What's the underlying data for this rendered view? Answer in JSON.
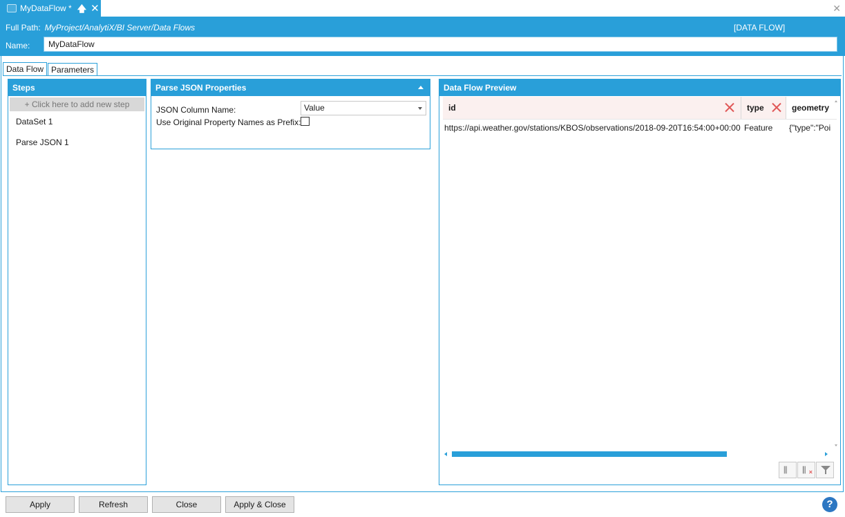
{
  "document_tab": {
    "title": "MyDataFlow *",
    "pin_glyph": "🡅",
    "close_glyph": "✕"
  },
  "window": {
    "close_glyph": "✕"
  },
  "header": {
    "full_path_label": "Full Path:",
    "full_path_value": "MyProject/AnalytiX/BI Server/Data Flows",
    "object_type": "[DATA FLOW]",
    "name_label": "Name:",
    "name_value": "MyDataFlow"
  },
  "tabs": [
    {
      "label": "Data Flow",
      "active": true
    },
    {
      "label": "Parameters",
      "active": false
    }
  ],
  "steps_panel": {
    "title": "Steps",
    "add_step": "+ Click here to add new step",
    "items": [
      {
        "label": "DataSet  1"
      },
      {
        "label": "Parse JSON  1"
      }
    ]
  },
  "properties_panel": {
    "title": "Parse JSON Properties",
    "json_column_label": "JSON Column Name:",
    "json_column_value": "Value",
    "prefix_label": "Use Original Property Names as Prefix:",
    "prefix_checked": false
  },
  "preview_panel": {
    "title": "Data Flow Preview",
    "columns": [
      "id",
      "type",
      "geometry"
    ],
    "rows": [
      {
        "id": "https://api.weather.gov/stations/KBOS/observations/2018-09-20T16:54:00+00:00",
        "type": "Feature",
        "geometry": "{\"type\":\"Poi"
      }
    ],
    "tools": [
      "add-column-icon",
      "remove-column-icon",
      "filter-icon"
    ]
  },
  "buttons": {
    "apply": "Apply",
    "refresh": "Refresh",
    "close": "Close",
    "apply_close": "Apply & Close",
    "help": "?"
  },
  "colors": {
    "accent": "#299fd9",
    "remove": "#e05858",
    "help": "#2d77c2"
  }
}
